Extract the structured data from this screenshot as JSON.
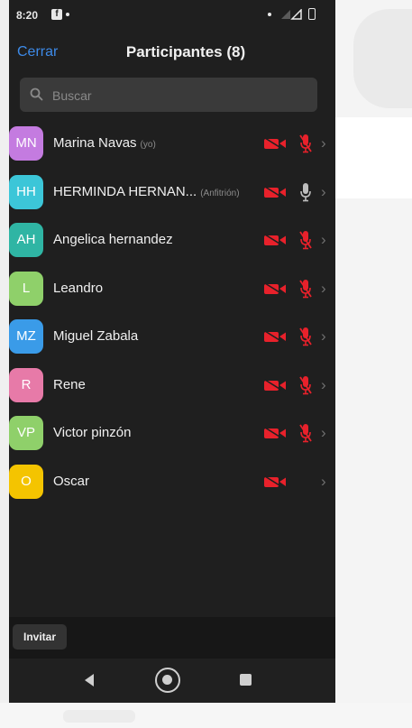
{
  "status_bar": {
    "time": "8:20",
    "app_icon": "f"
  },
  "header": {
    "close_label": "Cerrar",
    "title": "Participantes (8)"
  },
  "search": {
    "placeholder": "Buscar"
  },
  "participants": [
    {
      "initials": "MN",
      "name": "Marina Navas",
      "tag": "(yo)",
      "color": "#c47be0",
      "mic": "muted"
    },
    {
      "initials": "HH",
      "name": "HERMINDA HERNAN...",
      "tag": "(Anfitrión)",
      "color": "#3cc6d8",
      "mic": "on"
    },
    {
      "initials": "AH",
      "name": "Angelica hernandez",
      "tag": "",
      "color": "#2fb5a4",
      "mic": "muted"
    },
    {
      "initials": "L",
      "name": "Leandro",
      "tag": "",
      "color": "#8fd06a",
      "mic": "muted"
    },
    {
      "initials": "MZ",
      "name": "Miguel Zabala",
      "tag": "",
      "color": "#3a9be8",
      "mic": "muted"
    },
    {
      "initials": "R",
      "name": "Rene",
      "tag": "",
      "color": "#e77aa8",
      "mic": "muted"
    },
    {
      "initials": "VP",
      "name": "Victor pinzón",
      "tag": "",
      "color": "#8fd06a",
      "mic": "muted"
    },
    {
      "initials": "O",
      "name": "Oscar",
      "tag": "",
      "color": "#f4c400",
      "mic": "none"
    }
  ],
  "footer": {
    "invite_label": "Invitar"
  },
  "colors": {
    "muted_red": "#e8212b",
    "accent_blue": "#3d8ae8"
  }
}
